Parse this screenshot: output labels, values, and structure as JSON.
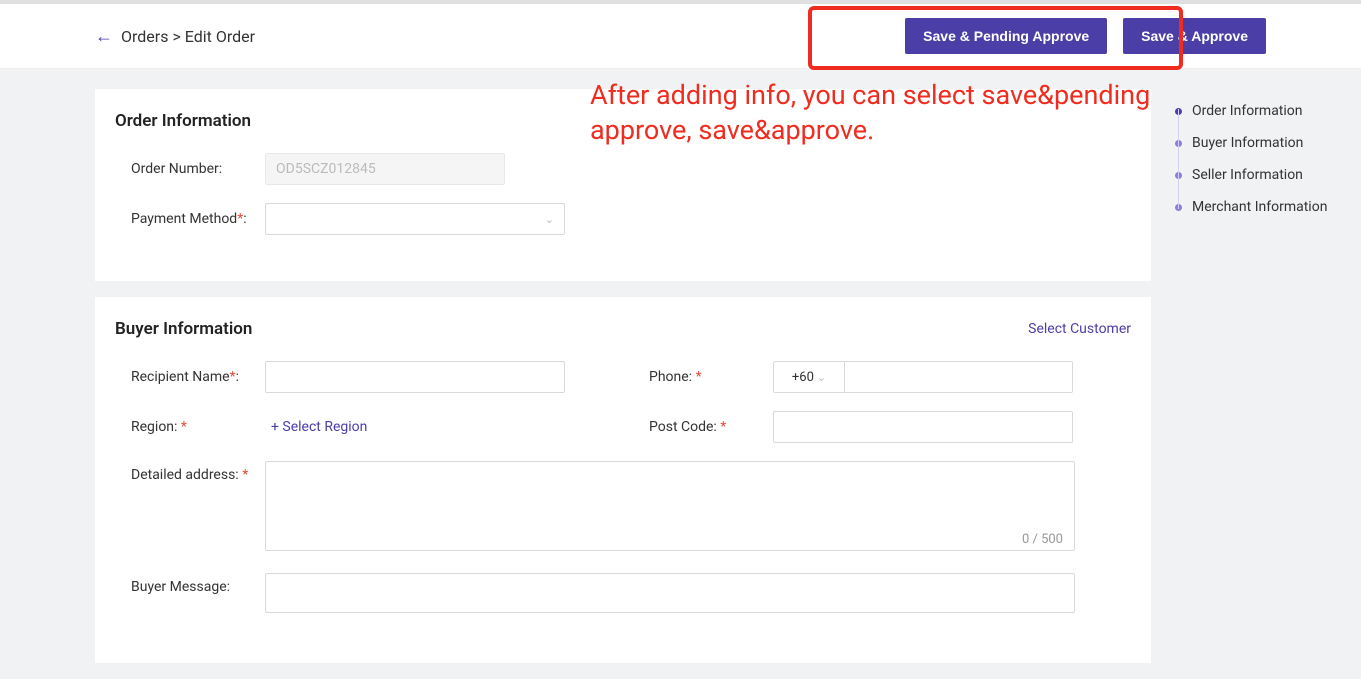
{
  "breadcrumb": {
    "root": "Orders",
    "sep": ">",
    "current": "Edit Order"
  },
  "header": {
    "save_pending_label": "Save & Pending Approve",
    "save_approve_label": "Save & Approve"
  },
  "annotation": {
    "text": "After adding info, you can select save&pending approve, save&approve."
  },
  "anchors": [
    {
      "label": "Order Information",
      "active": true
    },
    {
      "label": "Buyer Information",
      "active": false
    },
    {
      "label": "Seller Information",
      "active": false
    },
    {
      "label": "Merchant Information",
      "active": false
    }
  ],
  "order_info": {
    "title": "Order Information",
    "order_number_label": "Order Number:",
    "order_number_value": "OD5SCZ012845",
    "payment_method_label": "Payment Method",
    "payment_method_value": ""
  },
  "buyer_info": {
    "title": "Buyer Information",
    "select_customer": "Select Customer",
    "recipient_label": "Recipient Name",
    "phone_label": "Phone:",
    "phone_prefix": "+60",
    "region_label": "Region:",
    "select_region": "+ Select Region",
    "postcode_label": "Post Code:",
    "address_label": "Detailed address:",
    "char_count": "0 / 500",
    "buyer_message_label": "Buyer Message:"
  }
}
